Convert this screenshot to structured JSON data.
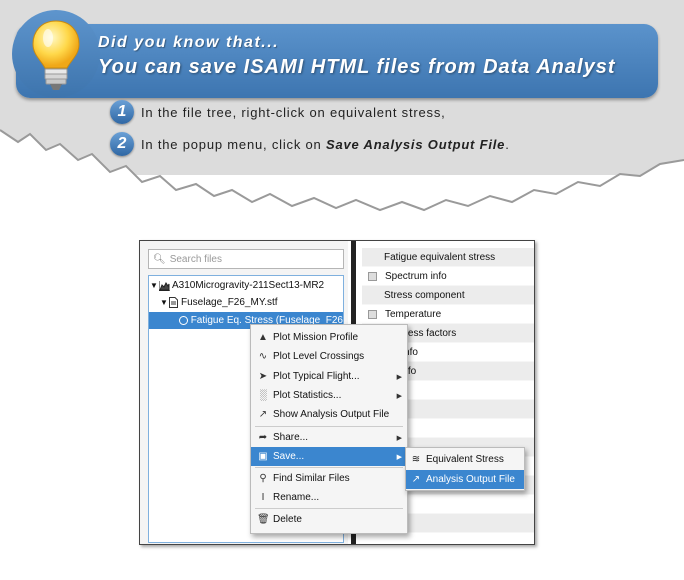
{
  "tip": {
    "title": "Did you know that...",
    "subtitle": "You can save ISAMI HTML files from Data Analyst"
  },
  "steps": [
    {
      "num": "1",
      "text": "In the file tree, right-click on equivalent stress,"
    },
    {
      "num": "2",
      "prefix": "In the popup menu, click on ",
      "emphasis": "Save Analysis Output File",
      "suffix": "."
    }
  ],
  "search": {
    "placeholder": "Search files"
  },
  "tree": [
    {
      "label": "A310Microgravity-211Sect13-MR2",
      "icon": "chart-file-icon"
    },
    {
      "label": "Fuselage_F26_MY.stf",
      "icon": "document-icon"
    },
    {
      "label": "Fatigue Eq. Stress (Fuselage_F26",
      "icon": "circle-icon",
      "selected": true
    }
  ],
  "properties": [
    {
      "label": "Fatigue equivalent stress",
      "expandable": false
    },
    {
      "label": "Spectrum info",
      "expandable": true
    },
    {
      "label": "Stress component",
      "expandable": false
    },
    {
      "label": "Temperature",
      "expandable": true
    },
    {
      "label": "all stress factors",
      "expandable": false
    },
    {
      "label": "low info",
      "expandable": false
    },
    {
      "label": "rial info",
      "expandable": false
    }
  ],
  "context_menu": [
    {
      "label": "Plot Mission Profile",
      "icon": "chart-area-icon",
      "submenu": false
    },
    {
      "label": "Plot Level Crossings",
      "icon": "line-chart-icon",
      "submenu": false
    },
    {
      "label": "Plot Typical Flight...",
      "icon": "plane-icon",
      "submenu": true
    },
    {
      "label": "Plot Statistics...",
      "icon": "bar-chart-icon",
      "submenu": true
    },
    {
      "label": "Show Analysis Output File",
      "icon": "open-external-icon",
      "submenu": false
    },
    {
      "label": "Share...",
      "icon": "share-arrow-icon",
      "submenu": true
    },
    {
      "label": "Save...",
      "icon": "floppy-disk-icon",
      "submenu": true,
      "highlighted": true
    },
    {
      "label": "Find Similar Files",
      "icon": "magnifier-icon",
      "submenu": false
    },
    {
      "label": "Rename...",
      "icon": "text-cursor-icon",
      "submenu": false
    },
    {
      "label": "Delete",
      "icon": "trash-icon",
      "submenu": false
    }
  ],
  "save_submenu": [
    {
      "label": "Equivalent Stress",
      "icon": "wave-icon"
    },
    {
      "label": "Analysis Output File",
      "icon": "export-icon",
      "highlighted": true
    }
  ],
  "colors": {
    "banner": "#4a84c0",
    "selection": "#3b86cf",
    "tree_border": "#7fb0de"
  }
}
